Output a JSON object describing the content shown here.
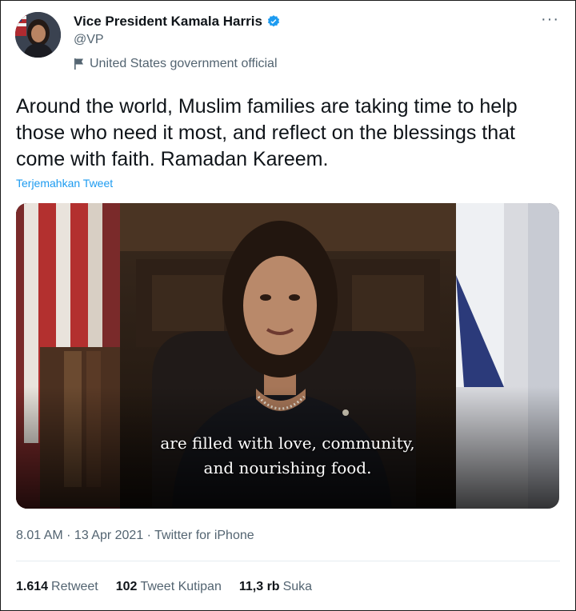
{
  "author": {
    "name": "Vice President Kamala Harris",
    "handle": "@VP",
    "label": "United States government official",
    "verified_icon": "verified-badge-icon",
    "avatar_icon": "avatar"
  },
  "tweet": {
    "text": "Around the world, Muslim families are taking time to help those who need it most, and reflect on the blessings that come with faith. Ramadan Kareem.",
    "translate_label": "Terjemahkan Tweet",
    "video_caption_line1": "are filled with love, community,",
    "video_caption_line2": "and nourishing food."
  },
  "meta": {
    "timestamp": "8.01 AM · 13 Apr 2021 · Twitter for iPhone"
  },
  "stats": {
    "retweets_count": "1.614",
    "retweets_label": "Retweet",
    "quotes_count": "102",
    "quotes_label": "Tweet Kutipan",
    "likes_count": "11,3 rb",
    "likes_label": "Suka"
  },
  "colors": {
    "accent": "#1d9bf0",
    "secondary_text": "#536471",
    "primary_text": "#0f1419"
  },
  "more_label": "···"
}
